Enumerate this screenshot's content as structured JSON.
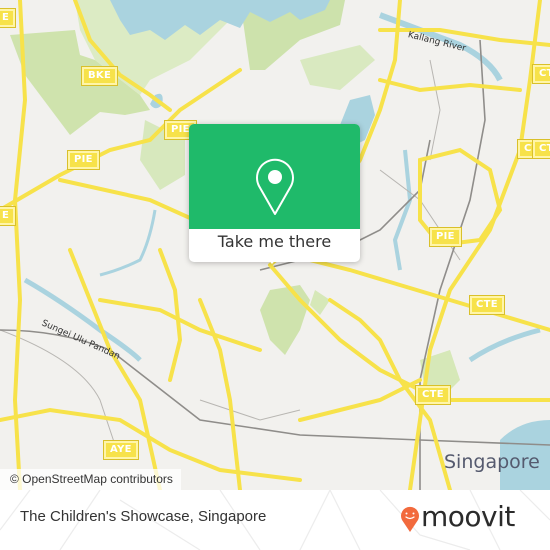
{
  "map": {
    "highway_shields": [
      {
        "label": "BKE"
      },
      {
        "label": "PIE"
      },
      {
        "label": "PIE"
      },
      {
        "label": "PIE"
      },
      {
        "label": "CTE"
      },
      {
        "label": "CTE"
      },
      {
        "label": "CTE"
      },
      {
        "label": "CTE"
      },
      {
        "label": "CTE"
      },
      {
        "label": "AYE"
      },
      {
        "label": "E"
      },
      {
        "label": "E"
      }
    ],
    "river_labels": {
      "kallang": "Kallang River",
      "ulu_pandan": "Sungei Ulu Pandan"
    },
    "city_label": "Singapore",
    "attribution": "© OpenStreetMap contributors",
    "colors": {
      "land": "#f2f1ee",
      "park": "#d6e8b8",
      "water": "#aad3df",
      "road": "#f7e24a"
    }
  },
  "popup": {
    "icon": "location-pin-icon",
    "button_label": "Take me there",
    "color": "#1fba6a"
  },
  "footer": {
    "place_name": "The Children's Showcase, Singapore",
    "brand": "moovit",
    "brand_color": "#f26a3d"
  }
}
